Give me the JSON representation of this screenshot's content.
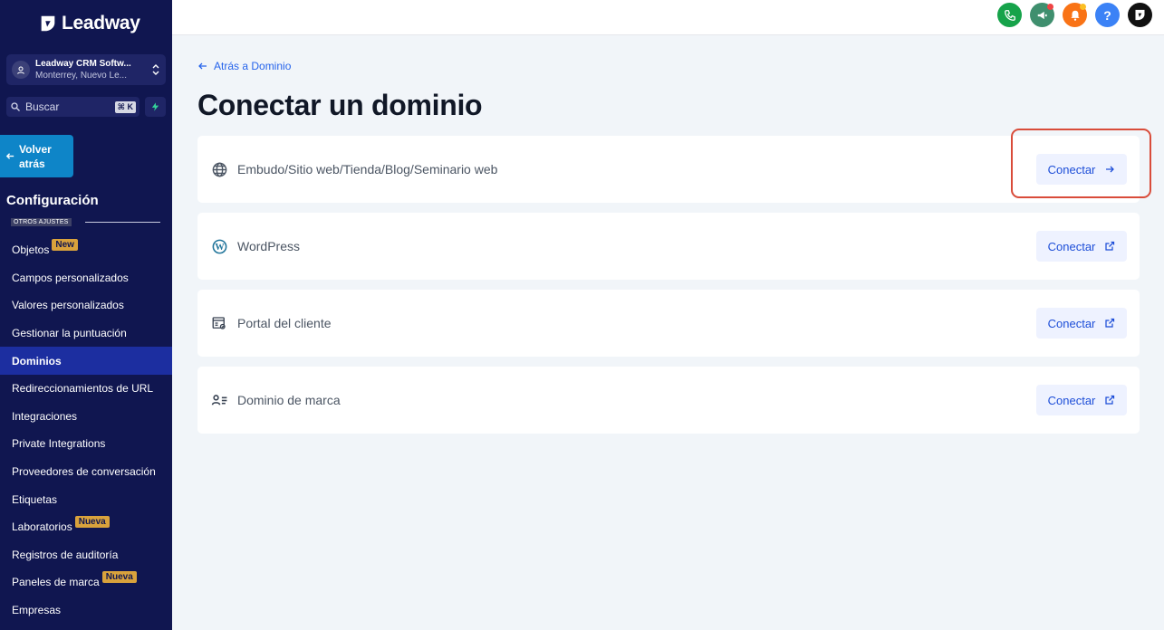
{
  "brand": {
    "name": "Leadway"
  },
  "account": {
    "name": "Leadway CRM Softw...",
    "location": "Monterrey, Nuevo Le..."
  },
  "search": {
    "placeholder": "Buscar",
    "shortcut": "⌘ K"
  },
  "back_button": {
    "label": "Volver atrás"
  },
  "sidebar": {
    "section_title": "Configuración",
    "section_tag": "OTROS AJUSTES",
    "items": [
      {
        "label": "Objetos",
        "badge": "New",
        "active": false
      },
      {
        "label": "Campos personalizados",
        "badge": "",
        "active": false
      },
      {
        "label": "Valores personalizados",
        "badge": "",
        "active": false
      },
      {
        "label": "Gestionar la puntuación",
        "badge": "",
        "active": false
      },
      {
        "label": "Dominios",
        "badge": "",
        "active": true
      },
      {
        "label": "Redireccionamientos de URL",
        "badge": "",
        "active": false
      },
      {
        "label": "Integraciones",
        "badge": "",
        "active": false
      },
      {
        "label": "Private Integrations",
        "badge": "",
        "active": false
      },
      {
        "label": "Proveedores de conversación",
        "badge": "",
        "active": false
      },
      {
        "label": "Etiquetas",
        "badge": "",
        "active": false
      },
      {
        "label": "Laboratorios",
        "badge": "Nueva",
        "active": false
      },
      {
        "label": "Registros de auditoría",
        "badge": "",
        "active": false
      },
      {
        "label": "Paneles de marca",
        "badge": "Nueva",
        "active": false
      },
      {
        "label": "Empresas",
        "badge": "",
        "active": false
      }
    ]
  },
  "topbar_icons": [
    {
      "name": "phone-icon",
      "color": "#16a34a"
    },
    {
      "name": "megaphone-icon",
      "color": "#3f8f6e",
      "dot": "#ef4444"
    },
    {
      "name": "bell-icon",
      "color": "#f97316",
      "dot": "#fbbf24"
    },
    {
      "name": "help-icon",
      "color": "#3b82f6"
    },
    {
      "name": "leadway-icon",
      "color": "#111111"
    }
  ],
  "breadcrumb": {
    "label": "Atrás a Dominio"
  },
  "page": {
    "title": "Conectar un dominio"
  },
  "options": [
    {
      "icon": "globe-icon",
      "label": "Embudo/Sitio web/Tienda/Blog/Seminario web",
      "button": "Conectar",
      "button_icon": "arrow-right-icon"
    },
    {
      "icon": "wordpress-icon",
      "label": "WordPress",
      "button": "Conectar",
      "button_icon": "external-link-icon"
    },
    {
      "icon": "client-portal-icon",
      "label": "Portal del cliente",
      "button": "Conectar",
      "button_icon": "external-link-icon"
    },
    {
      "icon": "brand-domain-icon",
      "label": "Dominio de marca",
      "button": "Conectar",
      "button_icon": "external-link-icon"
    }
  ],
  "colors": {
    "sidebar_bg": "#101650",
    "active_item": "#1c2ea0",
    "accent": "#2563eb",
    "highlight": "#d94c3a"
  }
}
